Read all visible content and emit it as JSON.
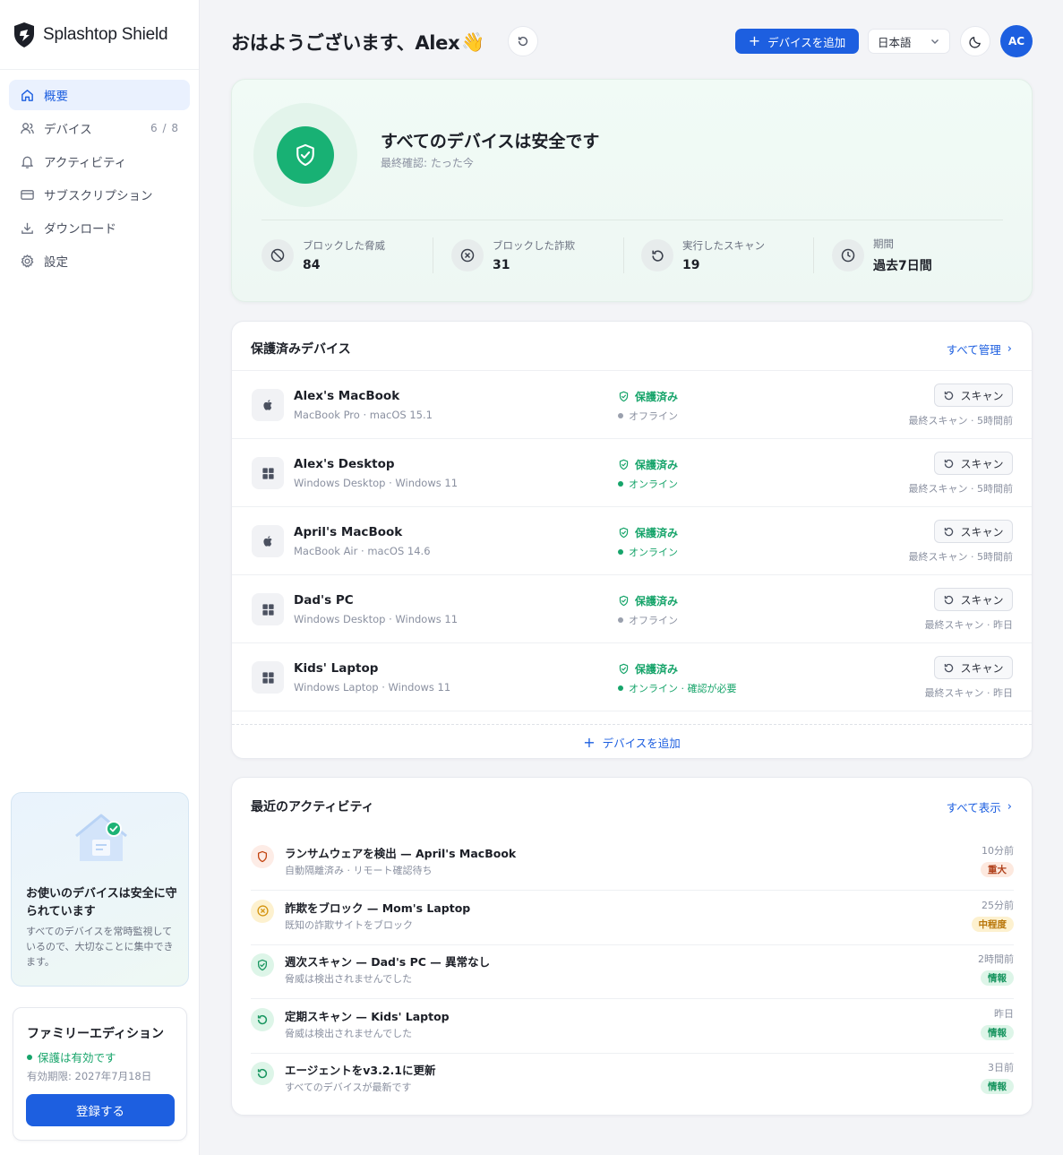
{
  "brand": {
    "name": "Splashtop Shield"
  },
  "nav": [
    {
      "label": "概要",
      "icon": "home-icon",
      "active": true,
      "count": ""
    },
    {
      "label": "デバイス",
      "icon": "users-icon",
      "active": false,
      "count": "6 / 8"
    },
    {
      "label": "アクティビティ",
      "icon": "bell-icon",
      "active": false,
      "count": ""
    },
    {
      "label": "サブスクリプション",
      "icon": "credit-card-icon",
      "active": false,
      "count": ""
    },
    {
      "label": "ダウンロード",
      "icon": "download-icon",
      "active": false,
      "count": ""
    },
    {
      "label": "設定",
      "icon": "gear-icon",
      "active": false,
      "count": ""
    }
  ],
  "promo": {
    "title": "お使いのデバイスは安全に守られています",
    "description": "すべてのデバイスを常時監視しているので、大切なことに集中できます。"
  },
  "plan": {
    "title": "ファミリーエディション",
    "status": "保護は有効です",
    "expiry": "有効期限: 2027年7月18日",
    "button": "登録する"
  },
  "header": {
    "greeting": "おはようございます、Alex",
    "wave": "👋",
    "add_device": "デバイスを追加",
    "language": "日本語",
    "avatar": "AC"
  },
  "hero": {
    "title": "すべてのデバイスは安全です",
    "subtitle": "最終確認: たった今",
    "stats": [
      {
        "label": "ブロックした脅威",
        "value": "84",
        "icon": "block-icon"
      },
      {
        "label": "ブロックした詐欺",
        "value": "31",
        "icon": "x-circle-icon"
      },
      {
        "label": "実行したスキャン",
        "value": "19",
        "icon": "refresh-icon"
      },
      {
        "label": "期間",
        "value": "過去7日間",
        "icon": "clock-icon"
      }
    ]
  },
  "devices": {
    "title": "保護済みデバイス",
    "manage_link": "すべて管理",
    "add_device": "デバイスを追加",
    "scan_label": "スキャン",
    "items": [
      {
        "name": "Alex's MacBook",
        "meta": "MacBook Pro · macOS 15.1",
        "os": "apple",
        "protection": "保護済み",
        "connection": "オフライン",
        "online": false,
        "last_scan": "最終スキャン · 5時間前"
      },
      {
        "name": "Alex's Desktop",
        "meta": "Windows Desktop · Windows 11",
        "os": "windows",
        "protection": "保護済み",
        "connection": "オンライン",
        "online": true,
        "last_scan": "最終スキャン · 5時間前"
      },
      {
        "name": "April's MacBook",
        "meta": "MacBook Air · macOS 14.6",
        "os": "apple",
        "protection": "保護済み",
        "connection": "オンライン",
        "online": true,
        "last_scan": "最終スキャン · 5時間前"
      },
      {
        "name": "Dad's PC",
        "meta": "Windows Desktop · Windows 11",
        "os": "windows",
        "protection": "保護済み",
        "connection": "オフライン",
        "online": false,
        "last_scan": "最終スキャン · 昨日"
      },
      {
        "name": "Kids' Laptop",
        "meta": "Windows Laptop · Windows 11",
        "os": "windows",
        "protection": "保護済み",
        "connection": "オンライン · 確認が必要",
        "online": true,
        "last_scan": "最終スキャン · 昨日"
      }
    ]
  },
  "activity": {
    "title": "最近のアクティビティ",
    "view_all": "すべて表示",
    "items": [
      {
        "title": "ランサムウェアを検出 — April's MacBook",
        "sub": "自動隔離済み · リモート確認待ち",
        "time": "10分前",
        "badge": "重大",
        "level": "critical",
        "icon": "shield-alert-icon"
      },
      {
        "title": "詐欺をブロック — Mom's Laptop",
        "sub": "既知の詐欺サイトをブロック",
        "time": "25分前",
        "badge": "中程度",
        "level": "medium",
        "icon": "x-circle-icon"
      },
      {
        "title": "週次スキャン — Dad's PC — 異常なし",
        "sub": "脅威は検出されませんでした",
        "time": "2時間前",
        "badge": "情報",
        "level": "info",
        "icon": "shield-check-icon"
      },
      {
        "title": "定期スキャン — Kids' Laptop",
        "sub": "脅威は検出されませんでした",
        "time": "昨日",
        "badge": "情報",
        "level": "info",
        "icon": "refresh-icon"
      },
      {
        "title": "エージェントをv3.2.1に更新",
        "sub": "すべてのデバイスが最新です",
        "time": "3日前",
        "badge": "情報",
        "level": "info",
        "icon": "refresh-icon"
      }
    ]
  },
  "colors": {
    "accent": "#1d5fe0",
    "success": "#16a46a",
    "critical": "#b0401a",
    "warning": "#b8760a"
  }
}
